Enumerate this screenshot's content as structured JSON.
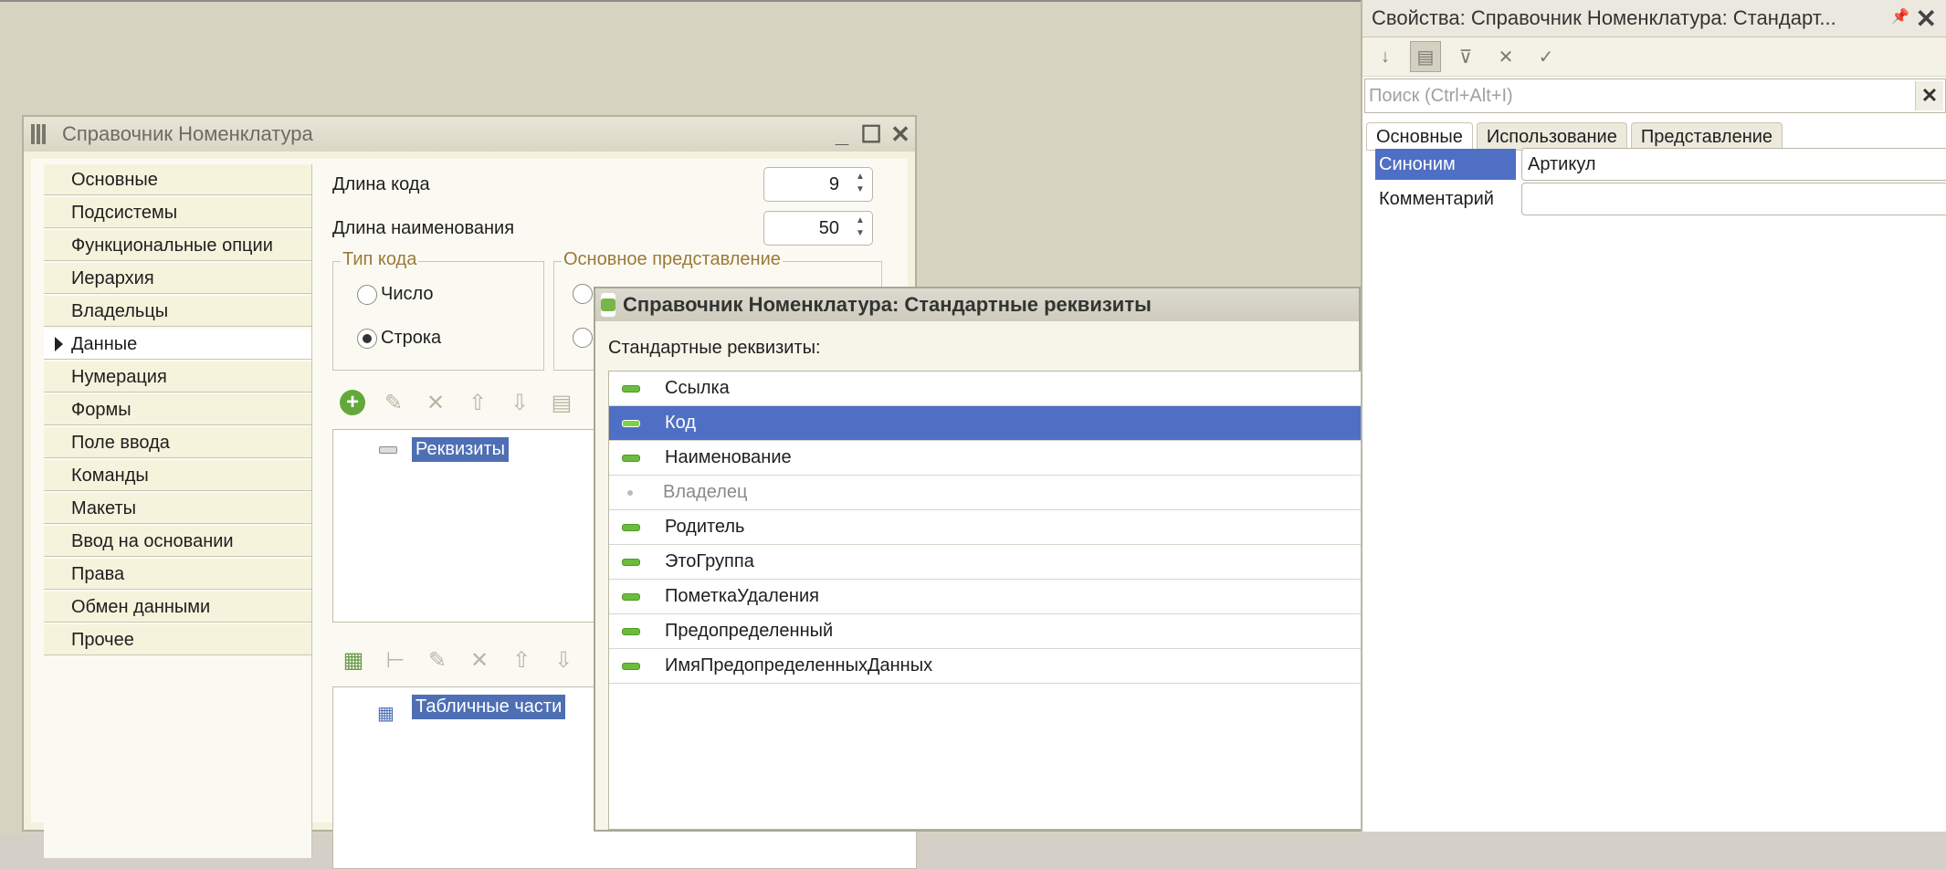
{
  "catalog_window": {
    "title": "Справочник Номенклатура",
    "sidebar": [
      {
        "label": "Основные"
      },
      {
        "label": "Подсистемы"
      },
      {
        "label": "Функциональные опции"
      },
      {
        "label": "Иерархия"
      },
      {
        "label": "Владельцы"
      },
      {
        "label": "Данные",
        "active": true
      },
      {
        "label": "Нумерация"
      },
      {
        "label": "Формы"
      },
      {
        "label": "Поле ввода"
      },
      {
        "label": "Команды"
      },
      {
        "label": "Макеты"
      },
      {
        "label": "Ввод на основании"
      },
      {
        "label": "Права"
      },
      {
        "label": "Обмен данными"
      },
      {
        "label": "Прочее"
      }
    ],
    "code_length_label": "Длина кода",
    "code_length_value": "9",
    "name_length_label": "Длина наименования",
    "name_length_value": "50",
    "code_type_group": "Тип кода",
    "code_type_options": [
      "Число",
      "Строка"
    ],
    "code_type_selected": "Строка",
    "main_presentation_group": "Основное представление",
    "attributes_node": "Реквизиты",
    "tabular_node": "Табличные части"
  },
  "std_attributes_window": {
    "title": "Справочник Номенклатура: Стандартные реквизиты",
    "subheader": "Стандартные реквизиты:",
    "items": [
      {
        "label": "Ссылка"
      },
      {
        "label": "Код",
        "selected": true
      },
      {
        "label": "Наименование"
      },
      {
        "label": "Владелец",
        "disabled": true
      },
      {
        "label": "Родитель"
      },
      {
        "label": "ЭтоГруппа"
      },
      {
        "label": "ПометкаУдаления"
      },
      {
        "label": "Предопределенный"
      },
      {
        "label": "ИмяПредопределенныхДанных"
      }
    ]
  },
  "properties": {
    "title": "Свойства: Справочник Номенклатура: Стандарт...",
    "search_placeholder": "Поиск (Ctrl+Alt+I)",
    "tabs": [
      "Основные",
      "Использование",
      "Представление"
    ],
    "active_tab": "Основные",
    "rows": [
      {
        "label": "Синоним",
        "value": "Артикул",
        "selected": true
      },
      {
        "label": "Комментарий",
        "value": ""
      }
    ]
  },
  "colors": {
    "selection": "#4f6fc5",
    "group_caption": "#9a7a3a",
    "attr_icon": "#6cbb3c"
  }
}
